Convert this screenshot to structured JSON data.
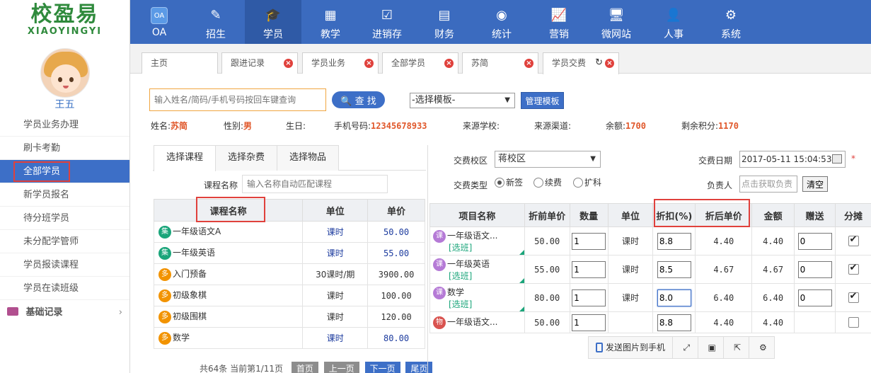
{
  "logo": {
    "cn": "校盈易",
    "en": "XIAOYINGYI"
  },
  "user": {
    "name": "王五"
  },
  "sidebar": {
    "items": [
      {
        "label": "学员业务办理",
        "active": false
      },
      {
        "label": "刷卡考勤",
        "active": false
      },
      {
        "label": "全部学员",
        "active": true
      },
      {
        "label": "新学员报名",
        "active": false
      },
      {
        "label": "待分班学员",
        "active": false
      },
      {
        "label": "未分配学管师",
        "active": false
      },
      {
        "label": "学员报读课程",
        "active": false
      },
      {
        "label": "学员在读班级",
        "active": false
      }
    ],
    "section": {
      "label": "基础记录",
      "chevron": "›"
    }
  },
  "topnav": {
    "items": [
      {
        "label": "OA",
        "icon": "oa-icon",
        "glyph": "OA"
      },
      {
        "label": "招生",
        "icon": "recruit-icon",
        "glyph": "✎"
      },
      {
        "label": "学员",
        "icon": "student-icon",
        "glyph": "🎓",
        "active": true
      },
      {
        "label": "教学",
        "icon": "blackboard-icon",
        "glyph": "▦"
      },
      {
        "label": "进销存",
        "icon": "inventory-icon",
        "glyph": "☑"
      },
      {
        "label": "财务",
        "icon": "abacus-icon",
        "glyph": "▤"
      },
      {
        "label": "统计",
        "icon": "stats-icon",
        "glyph": "◉"
      },
      {
        "label": "营销",
        "icon": "chart-icon",
        "glyph": "📈"
      },
      {
        "label": "微网站",
        "icon": "monitor-icon",
        "glyph": "🖥"
      },
      {
        "label": "人事",
        "icon": "hr-icon",
        "glyph": "👤"
      },
      {
        "label": "系统",
        "icon": "gear-icon",
        "glyph": "⚙"
      }
    ]
  },
  "tabs": [
    {
      "label": "主页",
      "closable": false
    },
    {
      "label": "跟进记录",
      "closable": true
    },
    {
      "label": "学员业务",
      "closable": true
    },
    {
      "label": "全部学员",
      "closable": true
    },
    {
      "label": "苏简",
      "closable": true
    },
    {
      "label": "学员交费",
      "closable": true,
      "active": true
    }
  ],
  "search": {
    "placeholder": "输入姓名/简码/手机号码按回车键查询",
    "button": "查 找",
    "template_select": "-选择模板-",
    "manage_button": "管理模板"
  },
  "student_info": {
    "name_label": "姓名:",
    "name": "苏简",
    "gender_label": "性别:",
    "gender": "男",
    "birthday_label": "生日:",
    "phone_label": "手机号码:",
    "phone": "12345678933",
    "school_label": "来源学校:",
    "channel_label": "来源渠道:",
    "balance_label": "余额:",
    "balance": "1700",
    "points_label": "剩余积分:",
    "points": "1170"
  },
  "left_panel": {
    "tabs": [
      "选择课程",
      "选择杂费",
      "选择物品"
    ],
    "course_name_label": "课程名称",
    "course_name_placeholder": "输入名称自动匹配课程",
    "columns": [
      "课程名称",
      "单位",
      "单价"
    ],
    "rows": [
      {
        "badge": "集",
        "color": "green",
        "name": "一年级语文A",
        "unit": "课时",
        "price": "50.00",
        "blue": true
      },
      {
        "badge": "集",
        "color": "green",
        "name": "一年级英语",
        "unit": "课时",
        "price": "55.00",
        "blue": true
      },
      {
        "badge": "多",
        "color": "orange",
        "name": "入门预备",
        "unit": "30课时/期",
        "price": "3900.00",
        "blue": false
      },
      {
        "badge": "多",
        "color": "orange",
        "name": "初级象棋",
        "unit": "课时",
        "price": "100.00",
        "blue": false
      },
      {
        "badge": "多",
        "color": "orange",
        "name": "初级围棋",
        "unit": "课时",
        "price": "120.00",
        "blue": false
      },
      {
        "badge": "多",
        "color": "orange",
        "name": "数学",
        "unit": "课时",
        "price": "80.00",
        "blue": true
      }
    ],
    "pager": {
      "summary": "共64条 当前第1/11页",
      "first": "首页",
      "prev": "上一页",
      "next": "下一页",
      "last": "尾页"
    }
  },
  "right_panel": {
    "campus_label": "交费校区",
    "campus": "蒋校区",
    "date_label": "交费日期",
    "date": "2017-05-11 15:04:53",
    "required": "*",
    "type_label": "交费类型",
    "types": [
      {
        "label": "新签",
        "checked": true
      },
      {
        "label": "续费",
        "checked": false
      },
      {
        "label": "扩科",
        "checked": false
      }
    ],
    "person_label": "负责人",
    "person_placeholder": "点击获取负责",
    "clear_button": "清空",
    "columns": [
      "项目名称",
      "折前单价",
      "数量",
      "单位",
      "折扣(%)",
      "折后单价",
      "金额",
      "赠送",
      "分摊"
    ],
    "rows": [
      {
        "badge": "课",
        "color": "purple",
        "name": "一年级语文...",
        "sub": "[选班]",
        "price": "50.00",
        "qty": "1",
        "unit": "课时",
        "discount": "8.8",
        "after": "4.40",
        "amount": "4.40",
        "gift": "0",
        "split": true
      },
      {
        "badge": "课",
        "color": "purple",
        "name": "一年级英语",
        "sub": "[选班]",
        "price": "55.00",
        "qty": "1",
        "unit": "课时",
        "discount": "8.5",
        "after": "4.67",
        "amount": "4.67",
        "gift": "0",
        "split": true
      },
      {
        "badge": "课",
        "color": "purple",
        "name": "数学",
        "sub": "[选班]",
        "price": "80.00",
        "qty": "1",
        "unit": "课时",
        "discount": "8.0",
        "after": "6.40",
        "amount": "6.40",
        "gift": "0",
        "split": true,
        "focus": true
      },
      {
        "badge": "物",
        "color": "red",
        "name": "一年级语文...",
        "sub": "",
        "price": "50.00",
        "qty": "1",
        "unit": "",
        "discount": "8.8",
        "after": "4.40",
        "amount": "4.40",
        "gift": "",
        "split": false
      }
    ],
    "bottom_bar": {
      "send_label": "发送图片到手机"
    }
  },
  "colors": {
    "primary": "#3b6bbf",
    "active_nav": "#2f5aa6",
    "accent": "#e0572a",
    "highlight": "#e0413c",
    "green": "#1aa57a"
  }
}
